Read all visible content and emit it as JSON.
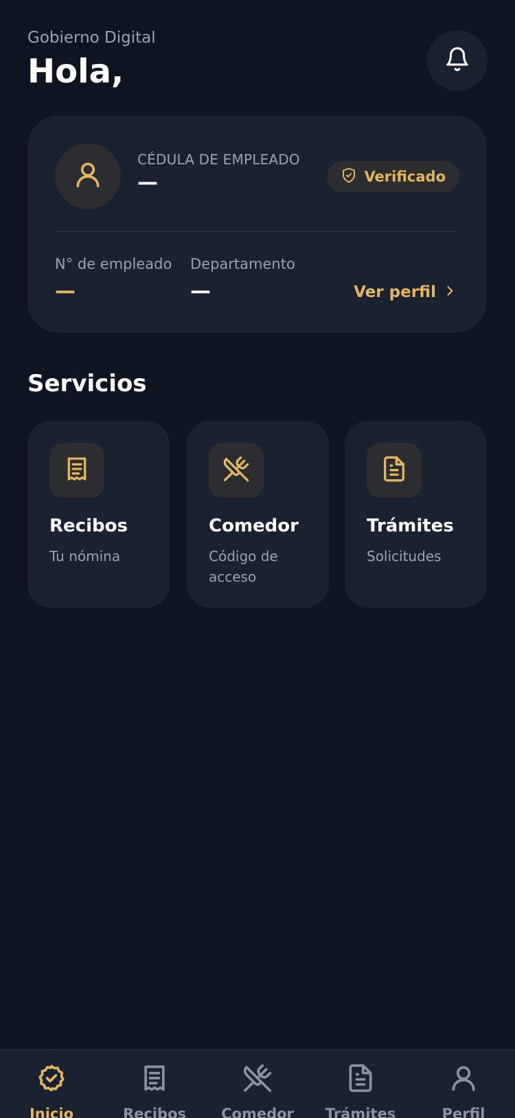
{
  "header": {
    "subtitle": "Gobierno Digital",
    "greeting": "Hola,",
    "bell_icon": "bell-icon"
  },
  "employee_card": {
    "avatar_icon": "user-icon",
    "cedula_label": "CÉDULA DE EMPLEADO",
    "cedula_value": "—",
    "badge_label": "Verificado",
    "badge_icon": "shield-check-icon",
    "employee_number_label": "N° de empleado",
    "employee_number_value": "—",
    "department_label": "Departamento",
    "department_value": "—",
    "profile_link_label": "Ver perfil"
  },
  "services": {
    "title": "Servicios",
    "items": [
      {
        "title": "Recibos",
        "subtitle": "Tu nómina",
        "icon": "receipt-icon"
      },
      {
        "title": "Comedor",
        "subtitle": "Código de acceso",
        "icon": "utensils-icon"
      },
      {
        "title": "Trámites",
        "subtitle": "Solicitudes",
        "icon": "document-icon"
      }
    ]
  },
  "tabbar": {
    "items": [
      {
        "label": "Inicio",
        "icon": "badge-check-icon",
        "active": true
      },
      {
        "label": "Recibos",
        "icon": "receipt-icon",
        "active": false
      },
      {
        "label": "Comedor",
        "icon": "utensils-icon",
        "active": false
      },
      {
        "label": "Trámites",
        "icon": "document-icon",
        "active": false
      },
      {
        "label": "Perfil",
        "icon": "user-icon",
        "active": false
      }
    ]
  },
  "colors": {
    "background": "#0e1420",
    "card": "#1a2130",
    "accent": "#e3b75a",
    "muted_text": "#9aa3b3",
    "icon_tile": "#2b2d31"
  }
}
